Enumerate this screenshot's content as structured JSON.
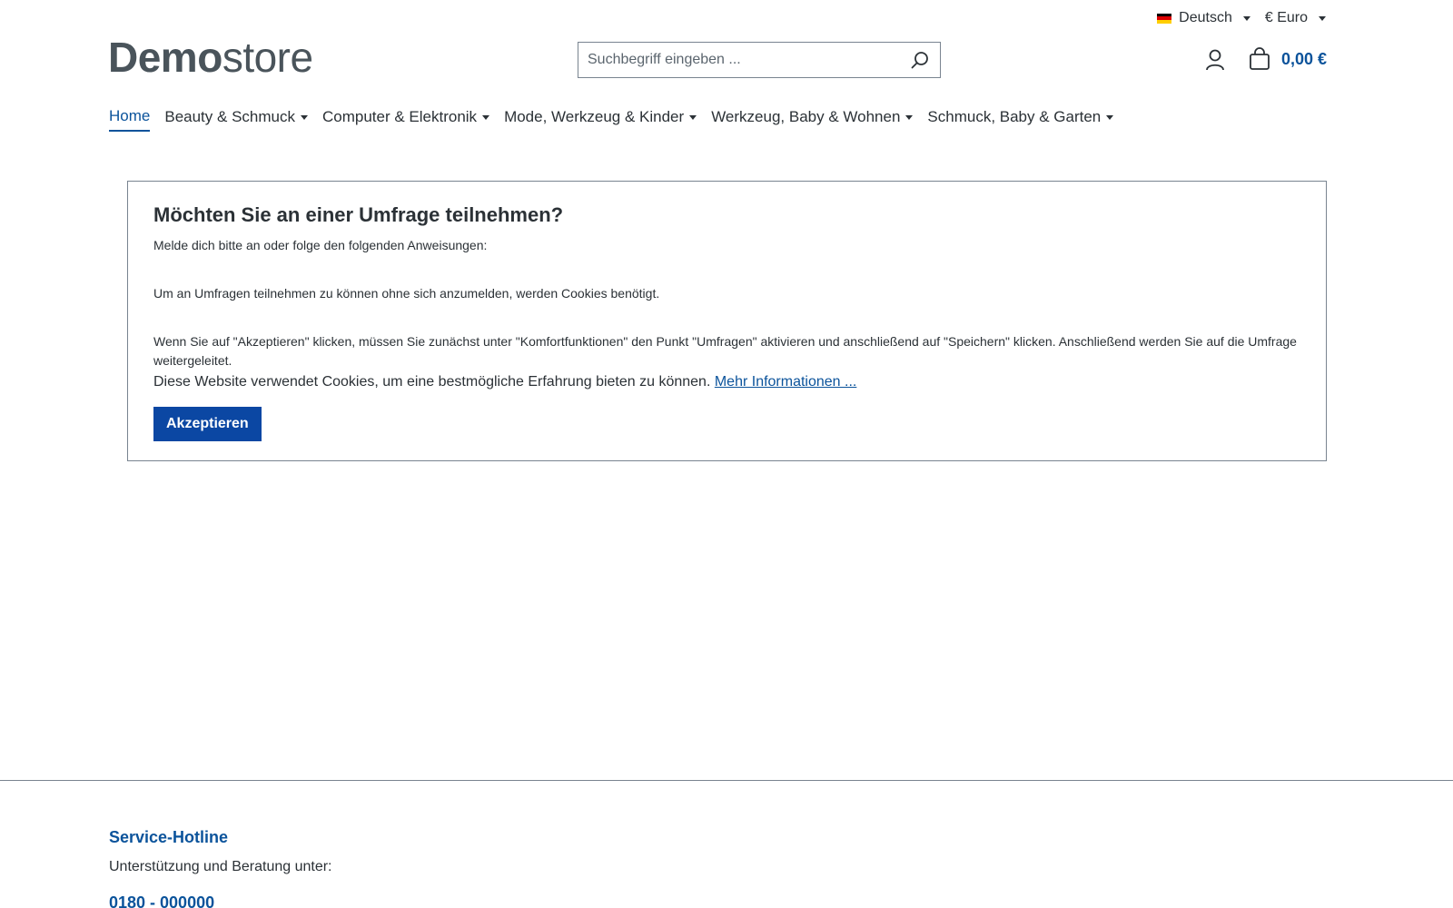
{
  "topbar": {
    "language_label": "Deutsch",
    "currency_label": "€ Euro"
  },
  "logo": {
    "bold": "Demo",
    "light": "store"
  },
  "search": {
    "placeholder": "Suchbegriff eingeben ..."
  },
  "cart": {
    "total": "0,00 €"
  },
  "nav": {
    "items": [
      {
        "label": "Home",
        "active": true
      },
      {
        "label": "Beauty & Schmuck"
      },
      {
        "label": "Computer & Elektronik"
      },
      {
        "label": "Mode, Werkzeug & Kinder"
      },
      {
        "label": "Werkzeug, Baby & Wohnen"
      },
      {
        "label": "Schmuck, Baby & Garten"
      }
    ]
  },
  "survey": {
    "title": "Möchten Sie an einer Umfrage teilnehmen?",
    "intro": "Melde dich bitte an oder folge den folgenden Anweisungen:",
    "cookies_needed": "Um an Umfragen teilnehmen zu können ohne sich anzumelden, werden Cookies benötigt.",
    "instructions": "Wenn Sie auf \"Akzeptieren\" klicken, müssen Sie zunächst unter \"Komfortfunktionen\" den Punkt \"Umfragen\" aktivieren und anschließend auf \"Speichern\" klicken. Anschließend werden Sie auf die Umfrage weitergeleitet.",
    "cookie_notice": "Diese Website verwendet Cookies, um eine bestmögliche Erfahrung bieten zu können.",
    "more_info_link": "Mehr Informationen ...",
    "accept_button": "Akzeptieren"
  },
  "footer": {
    "hotline_title": "Service-Hotline",
    "hotline_text": "Unterstützung und Beratung unter:",
    "phone": "0180 - 000000"
  },
  "colors": {
    "brand_blue": "#0b539b",
    "button_blue": "#0b47a3",
    "text": "#2b3136",
    "border": "#798490"
  },
  "icons": {
    "search": "search-icon",
    "account": "account-icon",
    "cart": "cart-icon",
    "flag": "german-flag-icon"
  }
}
